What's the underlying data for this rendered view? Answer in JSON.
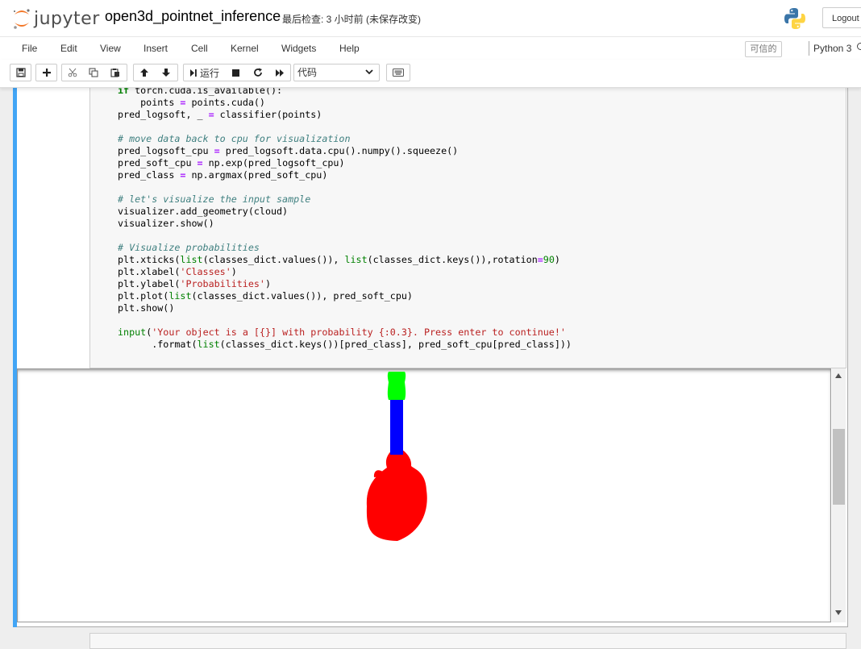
{
  "header": {
    "logo_text": "jupyter",
    "notebook_name": "open3d_pointnet_inference",
    "checkpoint_status": "最后检查: 3 小时前  (未保存改变)",
    "logout_label": "Logout"
  },
  "menubar": {
    "items": [
      "File",
      "Edit",
      "View",
      "Insert",
      "Cell",
      "Kernel",
      "Widgets",
      "Help"
    ],
    "trusted_label": "可信的",
    "kernel_name": "Python 3"
  },
  "toolbar": {
    "buttons": [
      "save-icon",
      "plus-icon",
      "scissors-icon",
      "copy-icon",
      "paste-icon",
      "arrow-up-icon",
      "arrow-down-icon",
      "run-icon",
      "stop-icon",
      "restart-icon",
      "fast-forward-icon",
      "keyboard-icon"
    ],
    "run_label": "运行",
    "cell_type": "代码"
  },
  "code": {
    "lines": [
      "if torch.cuda.is_available():",
      "    points = points.cuda()",
      "pred_logsoft, _ = classifier(points)",
      "",
      "# move data back to cpu for visualization",
      "pred_logsoft_cpu = pred_logsoft.data.cpu().numpy().squeeze()",
      "pred_soft_cpu = np.exp(pred_logsoft_cpu)",
      "pred_class = np.argmax(pred_soft_cpu)",
      "",
      "# let's visualize the input sample",
      "visualizer.add_geometry(cloud)",
      "visualizer.show()",
      "",
      "# Visualize probabilities",
      "plt.xticks(list(classes_dict.values()), list(classes_dict.keys()),rotation=90)",
      "plt.xlabel('Classes')",
      "plt.ylabel('Probabilities')",
      "plt.plot(list(classes_dict.values()), pred_soft_cpu)",
      "plt.show()",
      "",
      "input('Your object is a [{}] with probability {:0.3}. Press enter to continue!'",
      "      .format(list(classes_dict.keys())[pred_class], pred_soft_cpu[pred_class]))"
    ]
  },
  "output": {
    "segment_colors": {
      "head": "#00ff00",
      "neck": "#0000ff",
      "body": "#ff0000"
    }
  },
  "colors": {
    "cell_selected_bar": "#42a5f5",
    "jupyter_orange": "#f37626"
  }
}
